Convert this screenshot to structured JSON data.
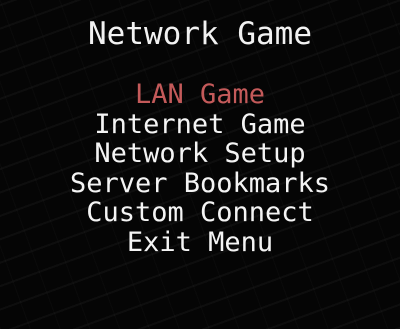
{
  "title": "Network Game",
  "menu": {
    "items": [
      {
        "label": "LAN Game",
        "selected": true
      },
      {
        "label": "Internet Game",
        "selected": false
      },
      {
        "label": "Network Setup",
        "selected": false
      },
      {
        "label": "Server Bookmarks",
        "selected": false
      },
      {
        "label": "Custom Connect",
        "selected": false
      },
      {
        "label": "Exit Menu",
        "selected": false
      }
    ]
  },
  "colors": {
    "text": "#f4f4f4",
    "selected": "#c45a5a",
    "background": "#050505"
  }
}
